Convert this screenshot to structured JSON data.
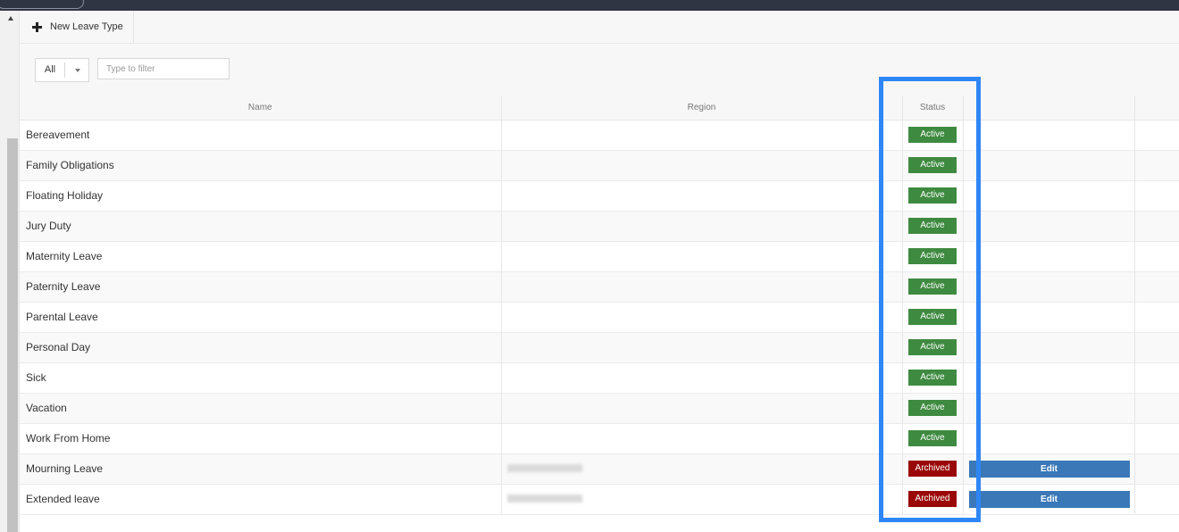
{
  "toolbar": {
    "new_button": "New Leave Type",
    "plus_icon": "plus-icon"
  },
  "filter": {
    "selected": "All",
    "placeholder": "Type to filter"
  },
  "table": {
    "columns": [
      "Name",
      "Region",
      "Status",
      "",
      ""
    ],
    "rows": [
      {
        "name": "Bereavement",
        "status": "Active"
      },
      {
        "name": "Family Obligations",
        "status": "Active"
      },
      {
        "name": "Floating Holiday",
        "status": "Active"
      },
      {
        "name": "Jury Duty",
        "status": "Active"
      },
      {
        "name": "Maternity Leave",
        "status": "Active"
      },
      {
        "name": "Paternity Leave",
        "status": "Active"
      },
      {
        "name": "Parental Leave",
        "status": "Active"
      },
      {
        "name": "Personal Day",
        "status": "Active"
      },
      {
        "name": "Sick",
        "status": "Active"
      },
      {
        "name": "Vacation",
        "status": "Active"
      },
      {
        "name": "Work From Home",
        "status": "Active"
      },
      {
        "name": "Mourning Leave",
        "status": "Archived",
        "action": "Edit"
      },
      {
        "name": "Extended leave",
        "status": "Archived",
        "action": "Edit"
      }
    ]
  },
  "colors": {
    "active": "#3e8a40",
    "archived": "#9a0707",
    "edit": "#3a78b7",
    "highlight": "#2f86f6"
  }
}
